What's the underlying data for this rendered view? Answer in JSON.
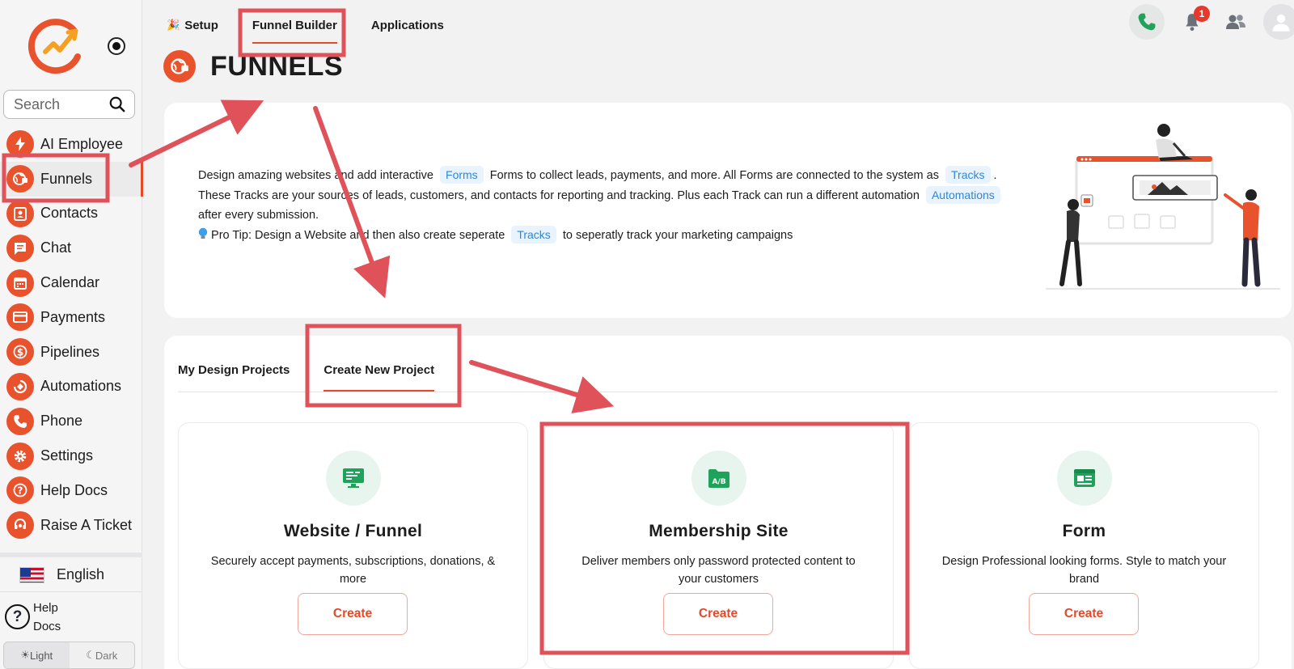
{
  "sidebar": {
    "search_placeholder": "Search",
    "items": [
      {
        "label": "AI Employee",
        "icon": "lightning-icon"
      },
      {
        "label": "Funnels",
        "icon": "funnel-globe-icon"
      },
      {
        "label": "Contacts",
        "icon": "contact-card-icon"
      },
      {
        "label": "Chat",
        "icon": "chat-bubble-icon"
      },
      {
        "label": "Calendar",
        "icon": "calendar-icon"
      },
      {
        "label": "Payments",
        "icon": "credit-card-icon"
      },
      {
        "label": "Pipelines",
        "icon": "dollar-icon"
      },
      {
        "label": "Automations",
        "icon": "automation-cycle-icon"
      },
      {
        "label": "Phone",
        "icon": "phone-icon"
      },
      {
        "label": "Settings",
        "icon": "gear-icon"
      },
      {
        "label": "Help Docs",
        "icon": "question-icon"
      },
      {
        "label": "Raise A Ticket",
        "icon": "headset-icon"
      }
    ],
    "active_item": "Funnels",
    "language": "English",
    "help_docs": "Help Docs",
    "theme_light": "Light",
    "theme_dark": "Dark"
  },
  "topnav": {
    "tabs": [
      "Setup",
      "Funnel Builder",
      "Applications"
    ],
    "active_tab": "Funnel Builder",
    "notification_count": "1"
  },
  "page": {
    "title": "FUNNELS"
  },
  "intro": {
    "line1_a": "Design amazing websites and add interactive",
    "chip_forms": "Forms",
    "line1_b": "Forms to collect leads, payments, and more. All Forms are connected to the system as",
    "chip_tracks": "Tracks",
    "line1_c": ".",
    "line2_a": "These Tracks are your sources of leads, customers, and contacts for reporting and tracking. Plus each Track can run a different automation",
    "chip_automations": "Automations",
    "line3": "after every submission.",
    "tip_icon": "lightbulb-icon",
    "tip_a": "Pro Tip: Design a Website and then also create seperate",
    "chip_tracks2": "Tracks",
    "tip_b": "to seperatly track your marketing campaigns"
  },
  "projects": {
    "tabs": [
      "My Design Projects",
      "Create New Project"
    ],
    "active_tab": "Create New Project",
    "cards": [
      {
        "title": "Website / Funnel",
        "description": "Securely accept payments, subscriptions, donations, & more",
        "button": "Create",
        "icon": "website-monitor-icon"
      },
      {
        "title": "Membership Site",
        "description": "Deliver members only password protected content to your customers",
        "button": "Create",
        "icon": "ab-test-folder-icon"
      },
      {
        "title": "Form",
        "description": "Design Professional looking forms. Style to match your brand",
        "button": "Create",
        "icon": "form-icon"
      }
    ]
  },
  "colors": {
    "accent": "#e8522d",
    "annotation_red": "#e0525a",
    "chip_bg": "#e9f3fd",
    "chip_text": "#2f86d6",
    "icon_green": "#1fa35b"
  }
}
